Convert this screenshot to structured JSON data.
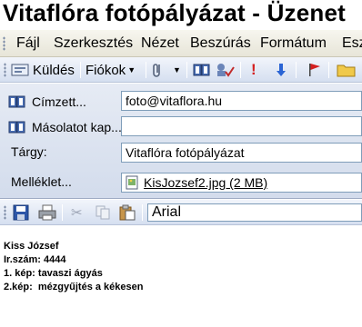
{
  "window": {
    "title": "Vitaflóra fotópályázat - Üzenet"
  },
  "menu": {
    "items": [
      "Fájl",
      "Szerkesztés",
      "Nézet",
      "Beszúrás",
      "Formátum",
      "Esz"
    ]
  },
  "toolbar": {
    "send_label": "Küldés",
    "accounts_label": "Fiókok"
  },
  "fields": {
    "to_label": "Címzett...",
    "to_value": "foto@vitaflora.hu",
    "cc_label": "Másolatot kap...",
    "cc_value": "",
    "subject_label": "Tárgy:",
    "subject_value": "Vitaflóra fotópályázat",
    "attach_label": "Melléklet...",
    "attachment": "KisJozsef2.jpg (2 MB)"
  },
  "format": {
    "font": "Arial"
  },
  "body": {
    "lines": [
      "Kiss József",
      "Ir.szám: 4444",
      "1. kép: tavaszi ágyás",
      "2.kép:  mézgyűjtés a kékesen"
    ]
  }
}
